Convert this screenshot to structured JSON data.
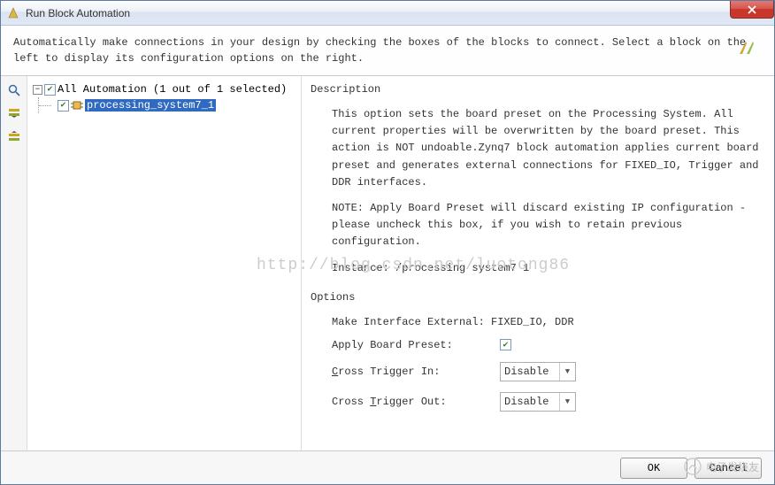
{
  "window": {
    "title": "Run Block Automation"
  },
  "instruction": "Automatically make connections in your design by checking the boxes of the blocks to connect. Select a block on the left to display its configuration options on the right.",
  "tree": {
    "root_label": "All Automation (1 out of 1 selected)",
    "root_checked": true,
    "child_label": "processing_system7_1",
    "child_checked": true
  },
  "description": {
    "heading": "Description",
    "p1": "This option sets the board preset on the Processing System. All current properties will be overwritten by the board preset. This action is NOT undoable.Zynq7 block automation applies current board preset and generates external connections for FIXED_IO, Trigger and DDR interfaces.",
    "p2": "NOTE: Apply Board Preset will discard existing IP configuration - please uncheck this box, if you wish to retain previous configuration.",
    "instance_label": "Instance: /processing system7 1"
  },
  "options": {
    "heading": "Options",
    "make_external_label": "Make Interface External: FIXED_IO, DDR",
    "apply_preset_label": "Apply Board Preset:",
    "apply_preset_checked": true,
    "cross_in_label_pre": "C",
    "cross_in_label_post": "ross Trigger In:",
    "cross_in_value": "Disable",
    "cross_out_label_pre": "Cross ",
    "cross_out_label_mid": "T",
    "cross_out_label_post": "rigger Out:",
    "cross_out_value": "Disable"
  },
  "footer": {
    "ok_label": "OK",
    "cancel_label": "Cancel"
  },
  "watermark": "http://blog.csdn.net/luotong86",
  "watermark2": "电子发烧友"
}
